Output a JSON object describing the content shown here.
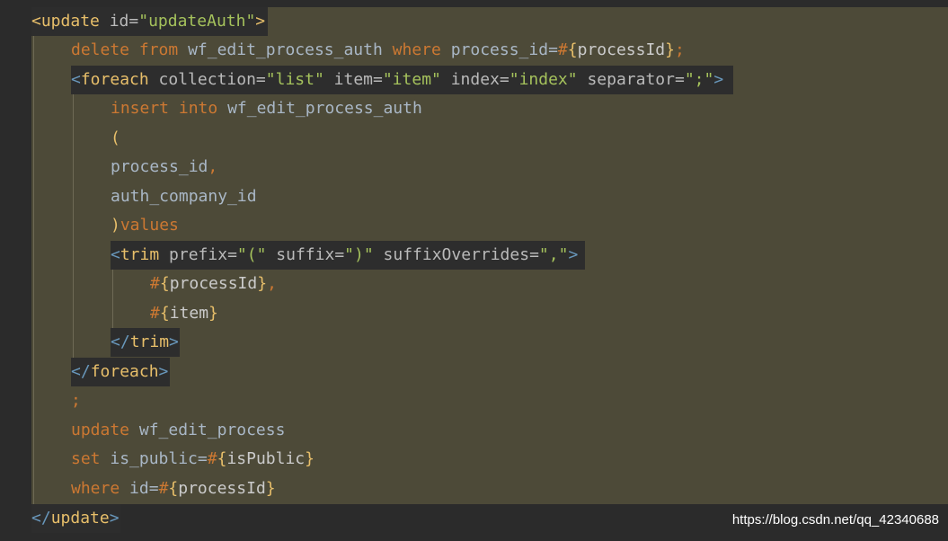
{
  "code": {
    "line1": {
      "open": "<",
      "tag": "update",
      "attr": "id",
      "eq": "=",
      "value": "\"updateAuth\"",
      "close": ">"
    },
    "line2": {
      "kw1": "delete",
      "kw2": "from",
      "table": "wf_edit_process_auth",
      "kw3": "where",
      "col": "process_id",
      "eq": "=",
      "hash": "#",
      "lb": "{",
      "param": "processId",
      "rb": "}",
      "semi": ";"
    },
    "line3": {
      "open": "<",
      "tag": "foreach",
      "attr1": "collection",
      "val1": "\"list\"",
      "attr2": "item",
      "val2": "\"item\"",
      "attr3": "index",
      "val3": "\"index\"",
      "attr4": "separator",
      "val4": "\";\"",
      "eq": "=",
      "close": ">"
    },
    "line4": {
      "kw1": "insert",
      "kw2": "into",
      "table": "wf_edit_process_auth"
    },
    "line5": {
      "paren": "("
    },
    "line6": {
      "col": "process_id",
      "comma": ","
    },
    "line7": {
      "col": "auth_company_id"
    },
    "line8": {
      "paren": ")",
      "kw": "values"
    },
    "line9": {
      "open": "<",
      "tag": "trim",
      "attr1": "prefix",
      "val1": "\"(\"",
      "attr2": "suffix",
      "val2": "\")\"",
      "attr3": "suffixOverrides",
      "val3": "\",\"",
      "eq": "=",
      "close": ">"
    },
    "line10": {
      "hash": "#",
      "lb": "{",
      "param": "processId",
      "rb": "}",
      "comma": ","
    },
    "line11": {
      "hash": "#",
      "lb": "{",
      "param": "item",
      "rb": "}"
    },
    "line12": {
      "open": "</",
      "tag": "trim",
      "close": ">"
    },
    "line13": {
      "open": "</",
      "tag": "foreach",
      "close": ">"
    },
    "line14": {
      "semi": ";"
    },
    "line15": {
      "kw": "update",
      "table": "wf_edit_process"
    },
    "line16": {
      "kw": "set",
      "col": "is_public",
      "eq": "=",
      "hash": "#",
      "lb": "{",
      "param": "isPublic",
      "rb": "}"
    },
    "line17": {
      "kw": "where",
      "col": "id",
      "eq": "=",
      "hash": "#",
      "lb": "{",
      "param": "processId",
      "rb": "}"
    },
    "line18": {
      "open": "</",
      "tag": "update",
      "close": ">"
    }
  },
  "watermark": "https://blog.csdn.net/qq_42340688"
}
